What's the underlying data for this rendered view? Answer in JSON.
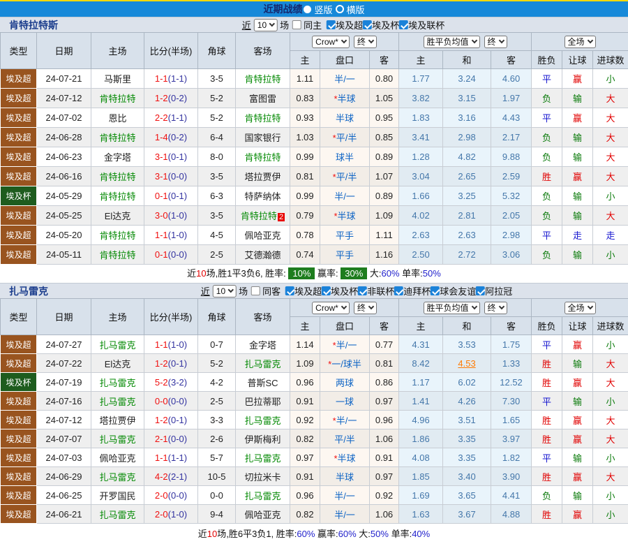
{
  "titlebar": {
    "title": "近期战绩",
    "radio_vertical": "竖版",
    "radio_horizontal": "横版"
  },
  "filters_labels": {
    "recent": "近",
    "matches": "场"
  },
  "cols": {
    "type": "类型",
    "date": "日期",
    "home": "主场",
    "score": "比分(半场)",
    "corner": "角球",
    "away": "客场",
    "dd_crow": "Crow*",
    "dd_end": "终",
    "dd_avg": "胜平负均值",
    "dd_full": "全场",
    "sub": [
      "主",
      "盘口",
      "客",
      "主",
      "和",
      "客",
      "胜负",
      "让球",
      "进球数"
    ]
  },
  "colors": {
    "accent_blue": "#1789D9",
    "league_super": "#99541F",
    "league_cup": "#1E5C1E",
    "badge_green": "#1E7D1E",
    "score_red": "#F01010",
    "focus_green": "#008800",
    "hot_orange": "#FF7A00"
  },
  "sections": [
    {
      "team": "肯特拉特斯",
      "filter": {
        "count": "10",
        "same_label": "同主",
        "same_checked": false,
        "leagues": [
          {
            "label": "埃及超",
            "checked": true
          },
          {
            "label": "埃及杯",
            "checked": true
          },
          {
            "label": "埃及联杯",
            "checked": true
          }
        ]
      },
      "rows": [
        {
          "type": "埃及超",
          "date": "24-07-21",
          "home": "马斯里",
          "home_focus": false,
          "score": "1-1",
          "half": "(1-1)",
          "corner": "3-5",
          "away": "肯特拉特",
          "away_focus": true,
          "o1": "1.11",
          "pan": "半/一",
          "o2": "0.80",
          "a1": "1.77",
          "a2": "3.24",
          "a3": "4.60",
          "res": "平",
          "hand": "赢",
          "goals": "小"
        },
        {
          "type": "埃及超",
          "date": "24-07-12",
          "home": "肯特拉特",
          "home_focus": true,
          "score": "1-2",
          "half": "(0-2)",
          "corner": "5-2",
          "away": "富图雷",
          "away_focus": false,
          "o1": "0.83",
          "pan": "*半球",
          "o2": "1.05",
          "a1": "3.82",
          "a2": "3.15",
          "a3": "1.97",
          "res": "负",
          "hand": "输",
          "goals": "大"
        },
        {
          "type": "埃及超",
          "date": "24-07-02",
          "home": "恩比",
          "home_focus": false,
          "score": "2-2",
          "half": "(1-1)",
          "corner": "5-2",
          "away": "肯特拉特",
          "away_focus": true,
          "o1": "0.93",
          "pan": "半球",
          "o2": "0.95",
          "a1": "1.83",
          "a2": "3.16",
          "a3": "4.43",
          "res": "平",
          "hand": "赢",
          "goals": "大"
        },
        {
          "type": "埃及超",
          "date": "24-06-28",
          "home": "肯特拉特",
          "home_focus": true,
          "score": "1-4",
          "half": "(0-2)",
          "corner": "6-4",
          "away": "国家银行",
          "away_focus": false,
          "o1": "1.03",
          "pan": "*平/半",
          "o2": "0.85",
          "a1": "3.41",
          "a2": "2.98",
          "a3": "2.17",
          "res": "负",
          "hand": "输",
          "goals": "大"
        },
        {
          "type": "埃及超",
          "date": "24-06-23",
          "home": "金字塔",
          "home_focus": false,
          "score": "3-1",
          "half": "(0-1)",
          "corner": "8-0",
          "away": "肯特拉特",
          "away_focus": true,
          "o1": "0.99",
          "pan": "球半",
          "o2": "0.89",
          "a1": "1.28",
          "a2": "4.82",
          "a3": "9.88",
          "res": "负",
          "hand": "输",
          "goals": "大"
        },
        {
          "type": "埃及超",
          "date": "24-06-16",
          "home": "肯特拉特",
          "home_focus": true,
          "score": "3-1",
          "half": "(0-0)",
          "corner": "3-5",
          "away": "塔拉贾伊",
          "away_focus": false,
          "o1": "0.81",
          "pan": "*平/半",
          "o2": "1.07",
          "a1": "3.04",
          "a2": "2.65",
          "a3": "2.59",
          "res": "胜",
          "hand": "赢",
          "goals": "大"
        },
        {
          "type": "埃及杯",
          "date": "24-05-29",
          "home": "肯特拉特",
          "home_focus": true,
          "score": "0-1",
          "half": "(0-1)",
          "corner": "6-3",
          "away": "特萨纳体",
          "away_focus": false,
          "o1": "0.99",
          "pan": "半/一",
          "o2": "0.89",
          "a1": "1.66",
          "a2": "3.25",
          "a3": "5.32",
          "res": "负",
          "hand": "输",
          "goals": "小"
        },
        {
          "type": "埃及超",
          "date": "24-05-25",
          "home": "El达克",
          "home_focus": false,
          "score": "3-0",
          "half": "(1-0)",
          "corner": "3-5",
          "away": "肯特拉特",
          "away_focus": true,
          "away_card": "2",
          "o1": "0.79",
          "pan": "*半球",
          "o2": "1.09",
          "a1": "4.02",
          "a2": "2.81",
          "a3": "2.05",
          "res": "负",
          "hand": "输",
          "goals": "大"
        },
        {
          "type": "埃及超",
          "date": "24-05-20",
          "home": "肯特拉特",
          "home_focus": true,
          "score": "1-1",
          "half": "(1-0)",
          "corner": "4-5",
          "away": "佩哈亚克",
          "away_focus": false,
          "o1": "0.78",
          "pan": "平手",
          "o2": "1.11",
          "a1": "2.63",
          "a2": "2.63",
          "a3": "2.98",
          "res": "平",
          "hand": "走",
          "goals": "走"
        },
        {
          "type": "埃及超",
          "date": "24-05-11",
          "home": "肯特拉特",
          "home_focus": true,
          "score": "0-1",
          "half": "(0-0)",
          "corner": "2-5",
          "away": "艾德瀚德",
          "away_focus": false,
          "o1": "0.74",
          "pan": "平手",
          "o2": "1.16",
          "a1": "2.50",
          "a2": "2.72",
          "a3": "3.06",
          "res": "负",
          "hand": "输",
          "goals": "小"
        }
      ],
      "summary": {
        "jin": "近",
        "count": "10",
        "rest": "场,胜1平3负6, 胜率:",
        "win": "10%",
        "win_badge": true,
        "yin_label": "赢率:",
        "yin": "30%",
        "yin_badge": true,
        "da_label": "大:",
        "da": "60%",
        "dan_label": "单率:",
        "dan": "50%"
      }
    },
    {
      "team": "扎马雷克",
      "filter": {
        "count": "10",
        "same_label": "同客",
        "same_checked": false,
        "leagues": [
          {
            "label": "埃及超",
            "checked": true
          },
          {
            "label": "埃及杯",
            "checked": true
          },
          {
            "label": "非联杯",
            "checked": true
          },
          {
            "label": "迪拜杯",
            "checked": true
          },
          {
            "label": "球会友谊",
            "checked": true
          },
          {
            "label": "阿拉冠",
            "checked": true
          }
        ]
      },
      "rows": [
        {
          "type": "埃及超",
          "date": "24-07-27",
          "home": "扎马雷克",
          "home_focus": true,
          "score": "1-1",
          "half": "(1-0)",
          "corner": "0-7",
          "away": "金字塔",
          "away_focus": false,
          "o1": "1.14",
          "pan": "*半/一",
          "o2": "0.77",
          "a1": "4.31",
          "a2": "3.53",
          "a3": "1.75",
          "res": "平",
          "hand": "赢",
          "goals": "小"
        },
        {
          "type": "埃及超",
          "date": "24-07-22",
          "home": "El达克",
          "home_focus": false,
          "score": "1-2",
          "half": "(0-1)",
          "corner": "5-2",
          "away": "扎马雷克",
          "away_focus": true,
          "o1": "1.09",
          "pan": "*一/球半",
          "o2": "0.81",
          "a1": "8.42",
          "a2": "4.53",
          "a2_hot": true,
          "a3": "1.33",
          "res": "胜",
          "hand": "输",
          "goals": "大"
        },
        {
          "type": "埃及杯",
          "date": "24-07-19",
          "home": "扎马雷克",
          "home_focus": true,
          "score": "5-2",
          "half": "(3-2)",
          "corner": "4-2",
          "away": "普斯SC",
          "away_focus": false,
          "o1": "0.96",
          "pan": "两球",
          "o2": "0.86",
          "a1": "1.17",
          "a2": "6.02",
          "a3": "12.52",
          "res": "胜",
          "hand": "赢",
          "goals": "大"
        },
        {
          "type": "埃及超",
          "date": "24-07-16",
          "home": "扎马雷克",
          "home_focus": true,
          "score": "0-0",
          "half": "(0-0)",
          "corner": "2-5",
          "away": "巴拉蒂耶",
          "away_focus": false,
          "o1": "0.91",
          "pan": "一球",
          "o2": "0.97",
          "a1": "1.41",
          "a2": "4.26",
          "a3": "7.30",
          "res": "平",
          "hand": "输",
          "goals": "小"
        },
        {
          "type": "埃及超",
          "date": "24-07-12",
          "home": "塔拉贾伊",
          "home_focus": false,
          "score": "1-2",
          "half": "(0-1)",
          "corner": "3-3",
          "away": "扎马雷克",
          "away_focus": true,
          "o1": "0.92",
          "pan": "*半/一",
          "o2": "0.96",
          "a1": "4.96",
          "a2": "3.51",
          "a3": "1.65",
          "res": "胜",
          "hand": "赢",
          "goals": "大"
        },
        {
          "type": "埃及超",
          "date": "24-07-07",
          "home": "扎马雷克",
          "home_focus": true,
          "score": "2-1",
          "half": "(0-0)",
          "corner": "2-6",
          "away": "伊斯梅利",
          "away_focus": false,
          "o1": "0.82",
          "pan": "平/半",
          "o2": "1.06",
          "a1": "1.86",
          "a2": "3.35",
          "a3": "3.97",
          "res": "胜",
          "hand": "赢",
          "goals": "大"
        },
        {
          "type": "埃及超",
          "date": "24-07-03",
          "home": "佩哈亚克",
          "home_focus": false,
          "score": "1-1",
          "half": "(1-1)",
          "corner": "5-7",
          "away": "扎马雷克",
          "away_focus": true,
          "o1": "0.97",
          "pan": "*半球",
          "o2": "0.91",
          "a1": "4.08",
          "a2": "3.35",
          "a3": "1.82",
          "res": "平",
          "hand": "输",
          "goals": "小"
        },
        {
          "type": "埃及超",
          "date": "24-06-29",
          "home": "扎马雷克",
          "home_focus": true,
          "score": "4-2",
          "half": "(2-1)",
          "corner": "10-5",
          "away": "切拉米卡",
          "away_focus": false,
          "o1": "0.91",
          "pan": "半球",
          "o2": "0.97",
          "a1": "1.85",
          "a2": "3.40",
          "a3": "3.90",
          "res": "胜",
          "hand": "赢",
          "goals": "大"
        },
        {
          "type": "埃及超",
          "date": "24-06-25",
          "home": "开罗国民",
          "home_focus": false,
          "score": "2-0",
          "half": "(0-0)",
          "corner": "0-0",
          "away": "扎马雷克",
          "away_focus": true,
          "o1": "0.96",
          "pan": "半/一",
          "o2": "0.92",
          "a1": "1.69",
          "a2": "3.65",
          "a3": "4.41",
          "res": "负",
          "hand": "输",
          "goals": "小"
        },
        {
          "type": "埃及超",
          "date": "24-06-21",
          "home": "扎马雷克",
          "home_focus": true,
          "score": "2-0",
          "half": "(1-0)",
          "corner": "9-4",
          "away": "佩哈亚克",
          "away_focus": false,
          "o1": "0.82",
          "pan": "半/一",
          "o2": "1.06",
          "a1": "1.63",
          "a2": "3.67",
          "a3": "4.88",
          "res": "胜",
          "hand": "赢",
          "goals": "小"
        }
      ],
      "summary": {
        "jin": "近",
        "count": "10",
        "rest": "场,胜6平3负1, 胜率:",
        "win": "60%",
        "win_badge": false,
        "yin_label": "赢率:",
        "yin": "60%",
        "yin_badge": false,
        "da_label": "大:",
        "da": "50%",
        "dan_label": "单率:",
        "dan": "40%"
      }
    }
  ]
}
